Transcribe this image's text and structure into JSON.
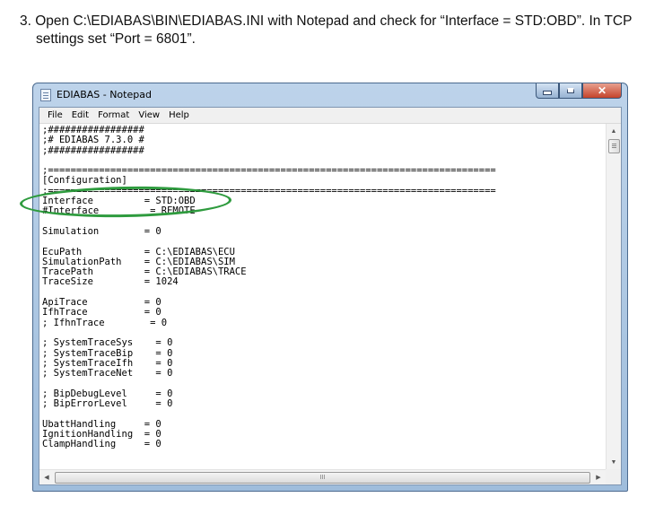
{
  "instruction": {
    "line1": "3. Open C:\\EDIABAS\\BIN\\EDIABAS.INI with Notepad and check for “Interface = STD:OBD”. In TCP",
    "line2": "settings set “Port = 6801”."
  },
  "window": {
    "title": "EDIABAS - Notepad",
    "icon": "notepad-icon",
    "buttons": {
      "minimize": "minimize-icon",
      "maximize": "maximize-icon",
      "close_label": "✕"
    }
  },
  "menu": [
    {
      "label": "File"
    },
    {
      "label": "Edit"
    },
    {
      "label": "Format"
    },
    {
      "label": "View"
    },
    {
      "label": "Help"
    }
  ],
  "editor": {
    "content": ";#################\n;# EDIABAS 7.3.0 #\n;#################\n\n;===============================================================================\n[Configuration]\n;===============================================================================\nInterface         = STD:OBD\n#Interface         = REMOTE\n\nSimulation        = 0\n\nEcuPath           = C:\\EDIABAS\\ECU\nSimulationPath    = C:\\EDIABAS\\SIM\nTracePath         = C:\\EDIABAS\\TRACE\nTraceSize         = 1024\n\nApiTrace          = 0\nIfhTrace          = 0\n; IfhnTrace        = 0\n\n; SystemTraceSys    = 0\n; SystemTraceBip    = 0\n; SystemTraceIfh    = 0\n; SystemTraceNet    = 0\n\n; BipDebugLevel     = 0\n; BipErrorLevel     = 0\n\nUbattHandling     = 0\nIgnitionHandling  = 0\nClampHandling     = 0"
  },
  "scrollbars": {
    "up_arrow": "▲",
    "down_arrow": "▼",
    "left_arrow": "◀",
    "right_arrow": "▶",
    "h_grip": "III"
  },
  "annotation": {
    "color": "#2e9b3e",
    "target": "Interface = STD:OBD"
  }
}
